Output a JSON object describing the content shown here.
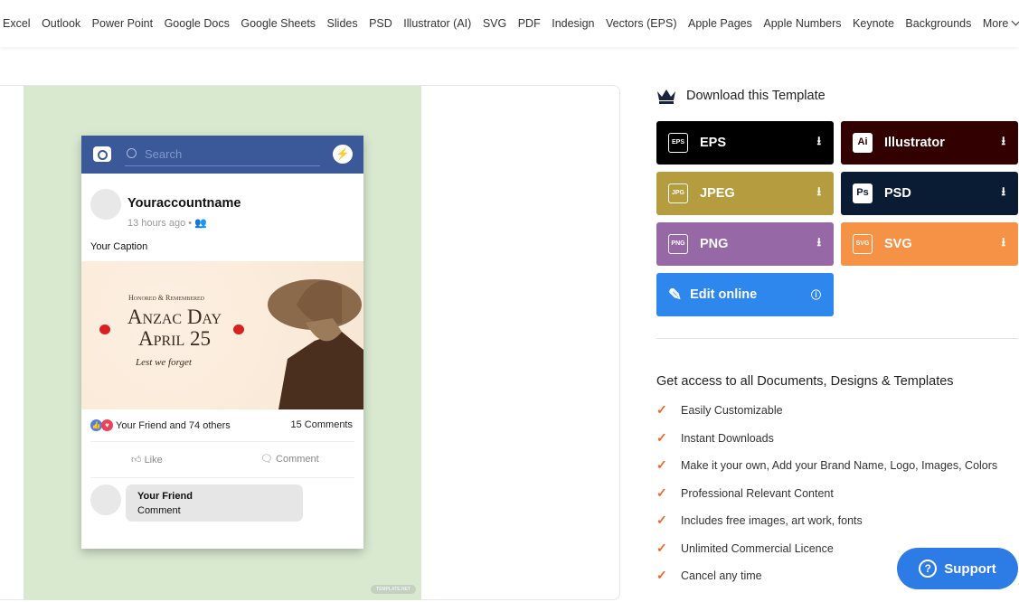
{
  "nav": [
    "Excel",
    "Outlook",
    "Power Point",
    "Google Docs",
    "Google Sheets",
    "Slides",
    "PSD",
    "Illustrator (AI)",
    "SVG",
    "PDF",
    "Indesign",
    "Vectors (EPS)",
    "Apple Pages",
    "Apple Numbers",
    "Keynote",
    "Backgrounds",
    "More"
  ],
  "preview": {
    "search_placeholder": "Search",
    "account": "Youraccountname",
    "time": "13 hours ago •",
    "caption": "Your Caption",
    "image": {
      "line1": "Honored & Remembered",
      "line2": "Anzac Day",
      "line3": "April 25",
      "line4": "Lest we forget"
    },
    "reactions": "Your Friend and 74 others",
    "comments_count": "15 Comments",
    "like": "Like",
    "comment": "Comment",
    "commenter": "Your Friend",
    "comment_text": "Comment",
    "watermark": "TEMPLATE.NET"
  },
  "download": {
    "title": "Download this Template",
    "buttons": [
      {
        "label": "EPS",
        "icon": "EPS",
        "color": "#000000"
      },
      {
        "label": "Illustrator",
        "icon": "Ai",
        "color": "#330000"
      },
      {
        "label": "JPEG",
        "icon": "JPG",
        "color": "#b59c3e"
      },
      {
        "label": "PSD",
        "icon": "Ps",
        "color": "#0a1c33"
      },
      {
        "label": "PNG",
        "icon": "PNG",
        "color": "#9668a6"
      },
      {
        "label": "SVG",
        "icon": "SVG",
        "color": "#f59245"
      },
      {
        "label": "Edit online",
        "icon": "pencil",
        "color": "#2d87ec"
      }
    ]
  },
  "access": {
    "title": "Get access to all Documents, Designs & Templates",
    "features": [
      "Easily Customizable",
      "Instant Downloads",
      "Make it your own, Add your Brand Name, Logo, Images, Colors",
      "Professional Relevant Content",
      "Includes free images, art work, fonts",
      "Unlimited Commercial Licence",
      "Cancel any time"
    ]
  },
  "support": "Support"
}
